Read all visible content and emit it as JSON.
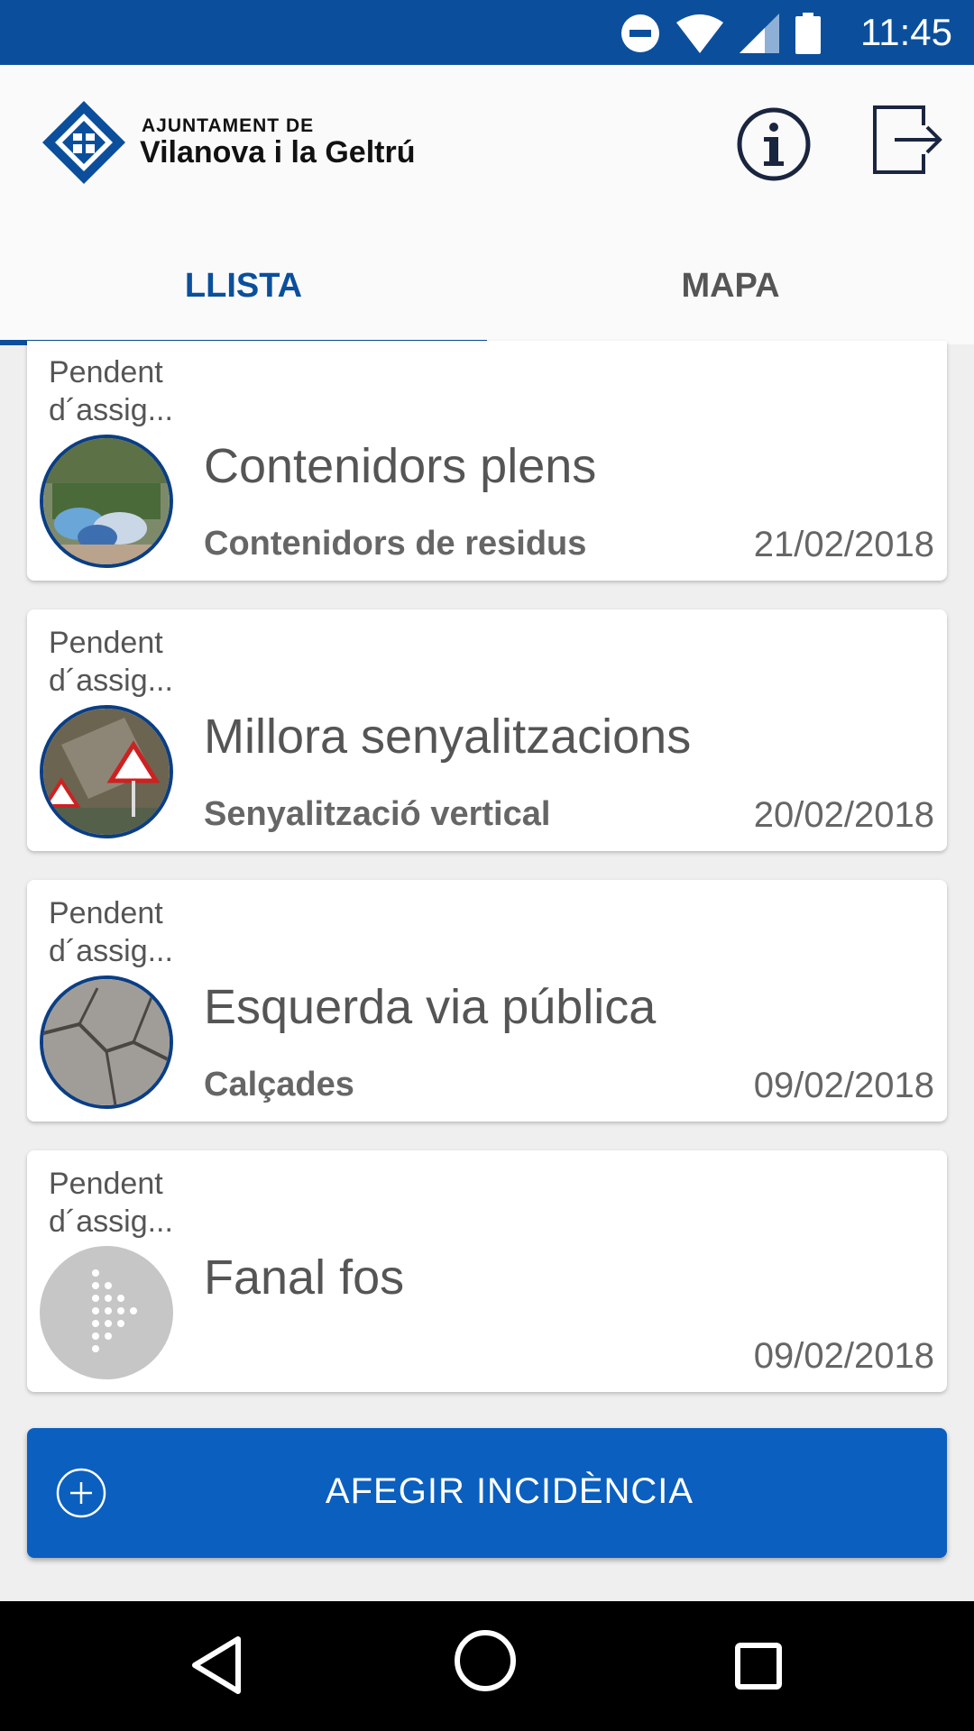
{
  "status_bar": {
    "time": "11:45"
  },
  "header": {
    "logo_line1": "AJUNTAMENT DE",
    "logo_line2": "Vilanova i la Geltrú"
  },
  "tabs": [
    {
      "label": "LLISTA",
      "active": true
    },
    {
      "label": "MAPA",
      "active": false
    }
  ],
  "incidents": [
    {
      "status": "Pendent d´assig...",
      "title": "Contenidors plens",
      "category": "Contenidors de residus",
      "date": "21/02/2018",
      "image": "garbage-containers-photo"
    },
    {
      "status": "Pendent d´assig...",
      "title": "Millora senyalitzacions",
      "category": "Senyalització vertical",
      "date": "20/02/2018",
      "image": "road-signs-photo"
    },
    {
      "status": "Pendent d´assig...",
      "title": "Esquerda via pública",
      "category": "Calçades",
      "date": "09/02/2018",
      "image": "cracked-pavement-photo"
    },
    {
      "status": "Pendent d´assig...",
      "title": "Fanal fos",
      "category": "",
      "date": "09/02/2018",
      "image": "placeholder-icon"
    }
  ],
  "add_button": {
    "label": "AFEGIR INCIDÈNCIA"
  },
  "colors": {
    "primary": "#0b4f9c",
    "button": "#0b5fbf"
  }
}
